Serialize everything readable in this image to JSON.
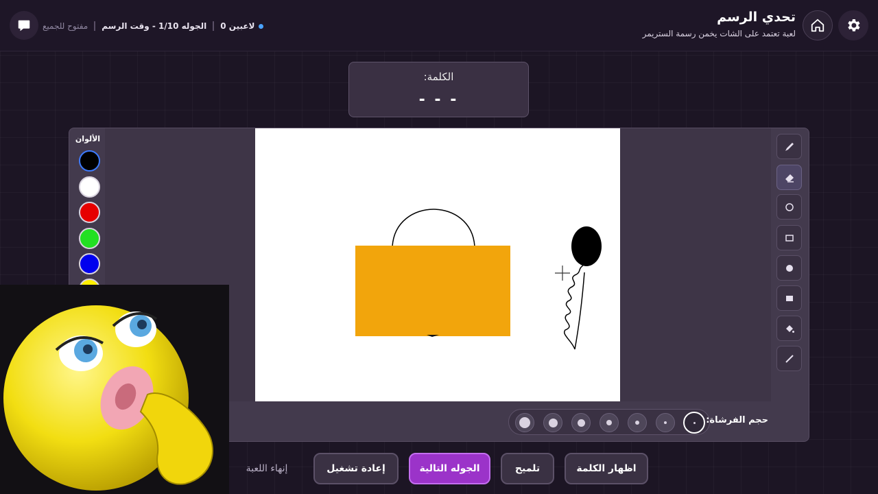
{
  "header": {
    "title": "تحدي الرسم",
    "subtitle": "لعبة تعتمد على الشات يخمن رسمة الستريمر",
    "status": {
      "players": "0 لاعبين",
      "round": "الجوله 1/10 - وقت الرسم",
      "access": "مفتوح للجميع"
    }
  },
  "word": {
    "label": "الكلمة:",
    "value": "- - -"
  },
  "colors": {
    "title": "الألوان",
    "swatches": [
      "#000000",
      "#ffffff",
      "#e60000",
      "#22e022",
      "#0000ee",
      "#ffee00"
    ]
  },
  "tools": [
    "pen-icon",
    "eraser-icon",
    "circle-outline-icon",
    "rectangle-outline-icon",
    "circle-filled-icon",
    "rectangle-filled-icon",
    "fill-bucket-icon",
    "line-icon"
  ],
  "brush": {
    "label": "حجم الفرشاة:"
  },
  "buttons": {
    "reveal_word": "اظهار الكلمة",
    "hint": "تلميح",
    "next_round": "الجوله التالية",
    "restart": "إعادة تشغيل",
    "end_game": "إنهاء اللعبة"
  },
  "accent_color": "#9b33c9"
}
